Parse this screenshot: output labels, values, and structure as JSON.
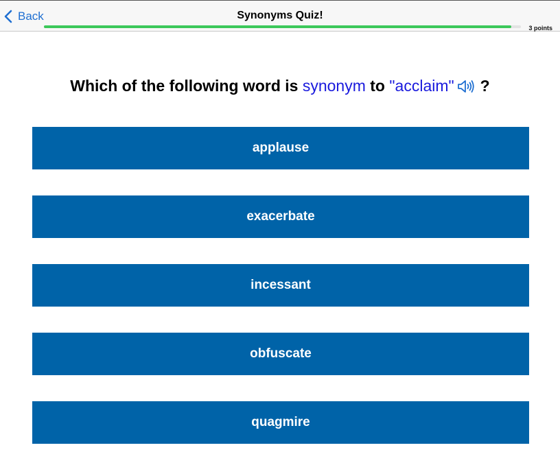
{
  "nav": {
    "back_label": "Back",
    "title": "Synonyms Quiz!",
    "points": "3 points",
    "progress": 0.98
  },
  "question": {
    "prefix": "Which of the following word is ",
    "keyword": "synonym",
    "middle": " to ",
    "word": "\"acclaim\"",
    "suffix": "?"
  },
  "options": [
    {
      "label": "applause"
    },
    {
      "label": "exacerbate"
    },
    {
      "label": "incessant"
    },
    {
      "label": "obfuscate"
    },
    {
      "label": "quagmire"
    }
  ],
  "colors": {
    "accent": "#1f6fd1",
    "option_bg": "#0063a8",
    "progress": "#3cc85a",
    "highlight": "#1a1add"
  },
  "icons": {
    "back": "chevron-left-icon",
    "audio": "speaker-icon"
  }
}
